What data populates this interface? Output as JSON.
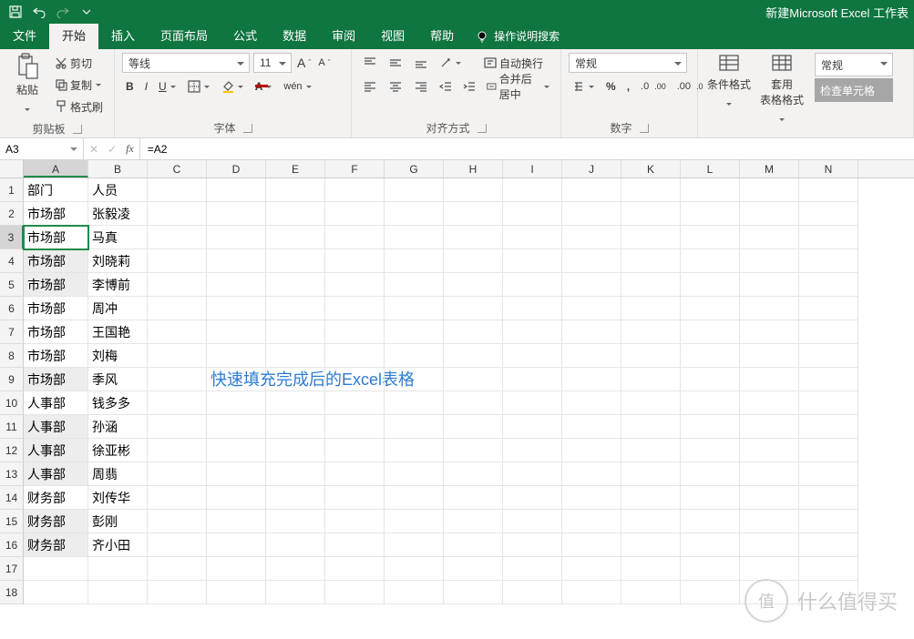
{
  "title": "新建Microsoft Excel 工作表",
  "tabs": {
    "file": "文件",
    "home": "开始",
    "insert": "插入",
    "layout": "页面布局",
    "formulas": "公式",
    "data": "数据",
    "review": "审阅",
    "view": "视图",
    "help": "帮助",
    "tell": "操作说明搜索"
  },
  "ribbon": {
    "clipboard": {
      "paste": "粘贴",
      "cut": "剪切",
      "copy": "复制",
      "painter": "格式刷",
      "label": "剪贴板"
    },
    "font": {
      "name": "等线",
      "size": "11",
      "label": "字体"
    },
    "align": {
      "wrap": "自动换行",
      "merge": "合并后居中",
      "label": "对齐方式"
    },
    "number": {
      "format": "常规",
      "label": "数字"
    },
    "styles": {
      "cond": "条件格式",
      "table": "套用\n表格格式",
      "normal": "常规",
      "check": "检查单元格"
    }
  },
  "namebox": "A3",
  "formula": "=A2",
  "columns": [
    "A",
    "B",
    "C",
    "D",
    "E",
    "F",
    "G",
    "H",
    "I",
    "J",
    "K",
    "L",
    "M",
    "N"
  ],
  "rows": [
    {
      "n": 1,
      "a": "部门",
      "b": "人员"
    },
    {
      "n": 2,
      "a": "市场部",
      "b": "张毅凌"
    },
    {
      "n": 3,
      "a": "市场部",
      "b": "马真",
      "sel": true
    },
    {
      "n": 4,
      "a": "市场部",
      "b": "刘晓莉",
      "shade": true
    },
    {
      "n": 5,
      "a": "市场部",
      "b": "李博前",
      "shade": true
    },
    {
      "n": 6,
      "a": "市场部",
      "b": "周冲"
    },
    {
      "n": 7,
      "a": "市场部",
      "b": "王国艳"
    },
    {
      "n": 8,
      "a": "市场部",
      "b": "刘梅"
    },
    {
      "n": 9,
      "a": "市场部",
      "b": "季风",
      "shade": true,
      "annot": "快速填充完成后的Excel表格"
    },
    {
      "n": 10,
      "a": "人事部",
      "b": "钱多多"
    },
    {
      "n": 11,
      "a": "人事部",
      "b": "孙涵",
      "shade": true
    },
    {
      "n": 12,
      "a": "人事部",
      "b": "徐亚彬",
      "shade": true
    },
    {
      "n": 13,
      "a": "人事部",
      "b": "周翡",
      "shade": true
    },
    {
      "n": 14,
      "a": "财务部",
      "b": "刘传华"
    },
    {
      "n": 15,
      "a": "财务部",
      "b": "彭刚",
      "shade": true
    },
    {
      "n": 16,
      "a": "财务部",
      "b": "齐小田",
      "shade": true
    },
    {
      "n": 17,
      "a": "",
      "b": ""
    },
    {
      "n": 18,
      "a": "",
      "b": ""
    }
  ],
  "watermark": {
    "badge": "值",
    "text": "什么值得买"
  }
}
